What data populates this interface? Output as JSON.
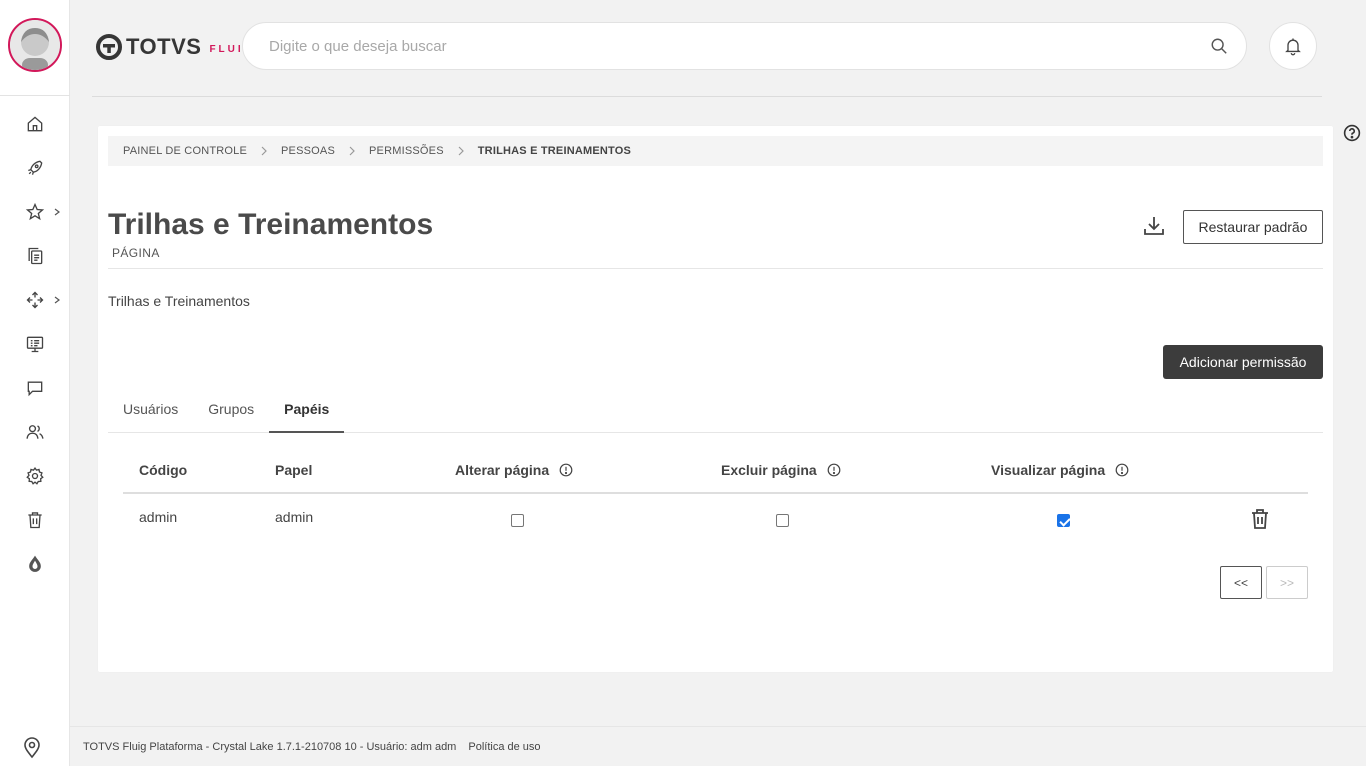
{
  "header": {
    "logo_text": "TOTVS",
    "logo_sub": "FLUIG",
    "search_placeholder": "Digite o que deseja buscar"
  },
  "breadcrumb": [
    "PAINEL DE CONTROLE",
    "PESSOAS",
    "PERMISSÕES",
    "TRILHAS E TREINAMENTOS"
  ],
  "page": {
    "title": "Trilhas e Treinamentos",
    "type": "PÁGINA",
    "description": "Trilhas e Treinamentos",
    "restore_label": "Restaurar padrão",
    "add_permission_label": "Adicionar permissão"
  },
  "tabs": [
    {
      "label": "Usuários",
      "active": false
    },
    {
      "label": "Grupos",
      "active": false
    },
    {
      "label": "Papéis",
      "active": true
    }
  ],
  "table": {
    "headers": {
      "code": "Código",
      "role": "Papel",
      "edit": "Alterar página",
      "delete": "Excluir página",
      "view": "Visualizar página"
    },
    "rows": [
      {
        "code": "admin",
        "role": "admin",
        "edit": false,
        "delete": false,
        "view": true
      }
    ]
  },
  "pager": {
    "prev": "<<",
    "next": ">>"
  },
  "footer": {
    "text": "TOTVS Fluig Plataforma - Crystal Lake 1.7.1-210708 10 - Usuário: adm adm",
    "policy": "Política de uso"
  },
  "colors": {
    "brand": "#d2185a",
    "checkbox": "#1a73e8",
    "dark_button": "#3c3c3c"
  }
}
